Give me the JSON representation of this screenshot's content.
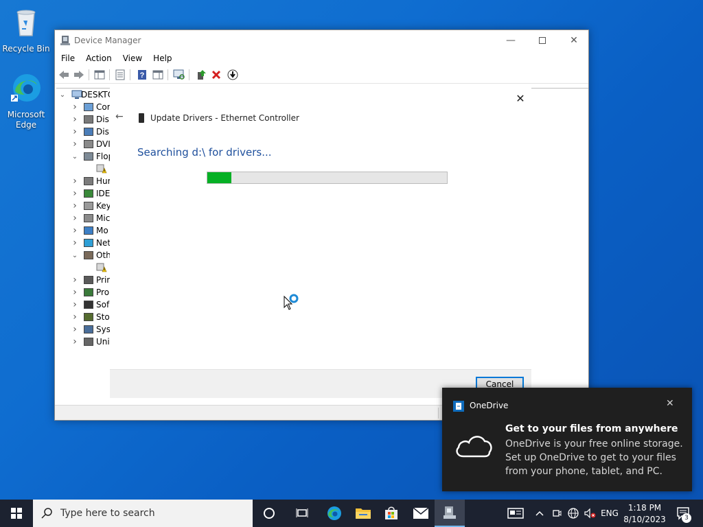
{
  "desktop": {
    "icons": [
      {
        "label": "Recycle Bin"
      },
      {
        "label": "Microsoft Edge"
      }
    ]
  },
  "window": {
    "title": "Device Manager",
    "menu": [
      "File",
      "Action",
      "View",
      "Help"
    ],
    "toolbar_icons": [
      "back-icon",
      "forward-icon",
      "properties-pane-icon",
      "list-view-icon",
      "help-icon",
      "action-pane-icon",
      "scan-hardware-icon",
      "update-driver-icon",
      "uninstall-icon",
      "download-icon"
    ],
    "tree": {
      "root": "DESKTO",
      "items": [
        {
          "label": "Cor",
          "expanded": false
        },
        {
          "label": "Disl",
          "expanded": false
        },
        {
          "label": "Disp",
          "expanded": false
        },
        {
          "label": "DVI",
          "expanded": false
        },
        {
          "label": "Flop",
          "expanded": true
        },
        {
          "label": "",
          "child": true
        },
        {
          "label": "Hur",
          "expanded": false
        },
        {
          "label": "IDE",
          "expanded": false
        },
        {
          "label": "Key",
          "expanded": false
        },
        {
          "label": "Mic",
          "expanded": false
        },
        {
          "label": "Mo",
          "expanded": false
        },
        {
          "label": "Net",
          "expanded": false
        },
        {
          "label": "Oth",
          "expanded": true
        },
        {
          "label": "",
          "child": true
        },
        {
          "label": "Prir",
          "expanded": false
        },
        {
          "label": "Pro",
          "expanded": false
        },
        {
          "label": "Sof",
          "expanded": false
        },
        {
          "label": "Sto",
          "expanded": false
        },
        {
          "label": "Sys",
          "expanded": false
        },
        {
          "label": "Uni",
          "expanded": false
        }
      ]
    }
  },
  "dialog": {
    "title": "Update Drivers - Ethernet Controller",
    "heading": "Searching d:\\ for drivers...",
    "progress": 0.1,
    "cancel_label": "Cancel",
    "accent": "#06b025"
  },
  "toast": {
    "app": "OneDrive",
    "headline": "Get to your files from anywhere",
    "body": "OneDrive is your free online storage. Set up OneDrive to get to your files from your phone, tablet, and PC."
  },
  "taskbar": {
    "search_placeholder": "Type here to search",
    "language": "ENG",
    "time": "1:18 PM",
    "date": "8/10/2023",
    "notification_count": "3"
  }
}
